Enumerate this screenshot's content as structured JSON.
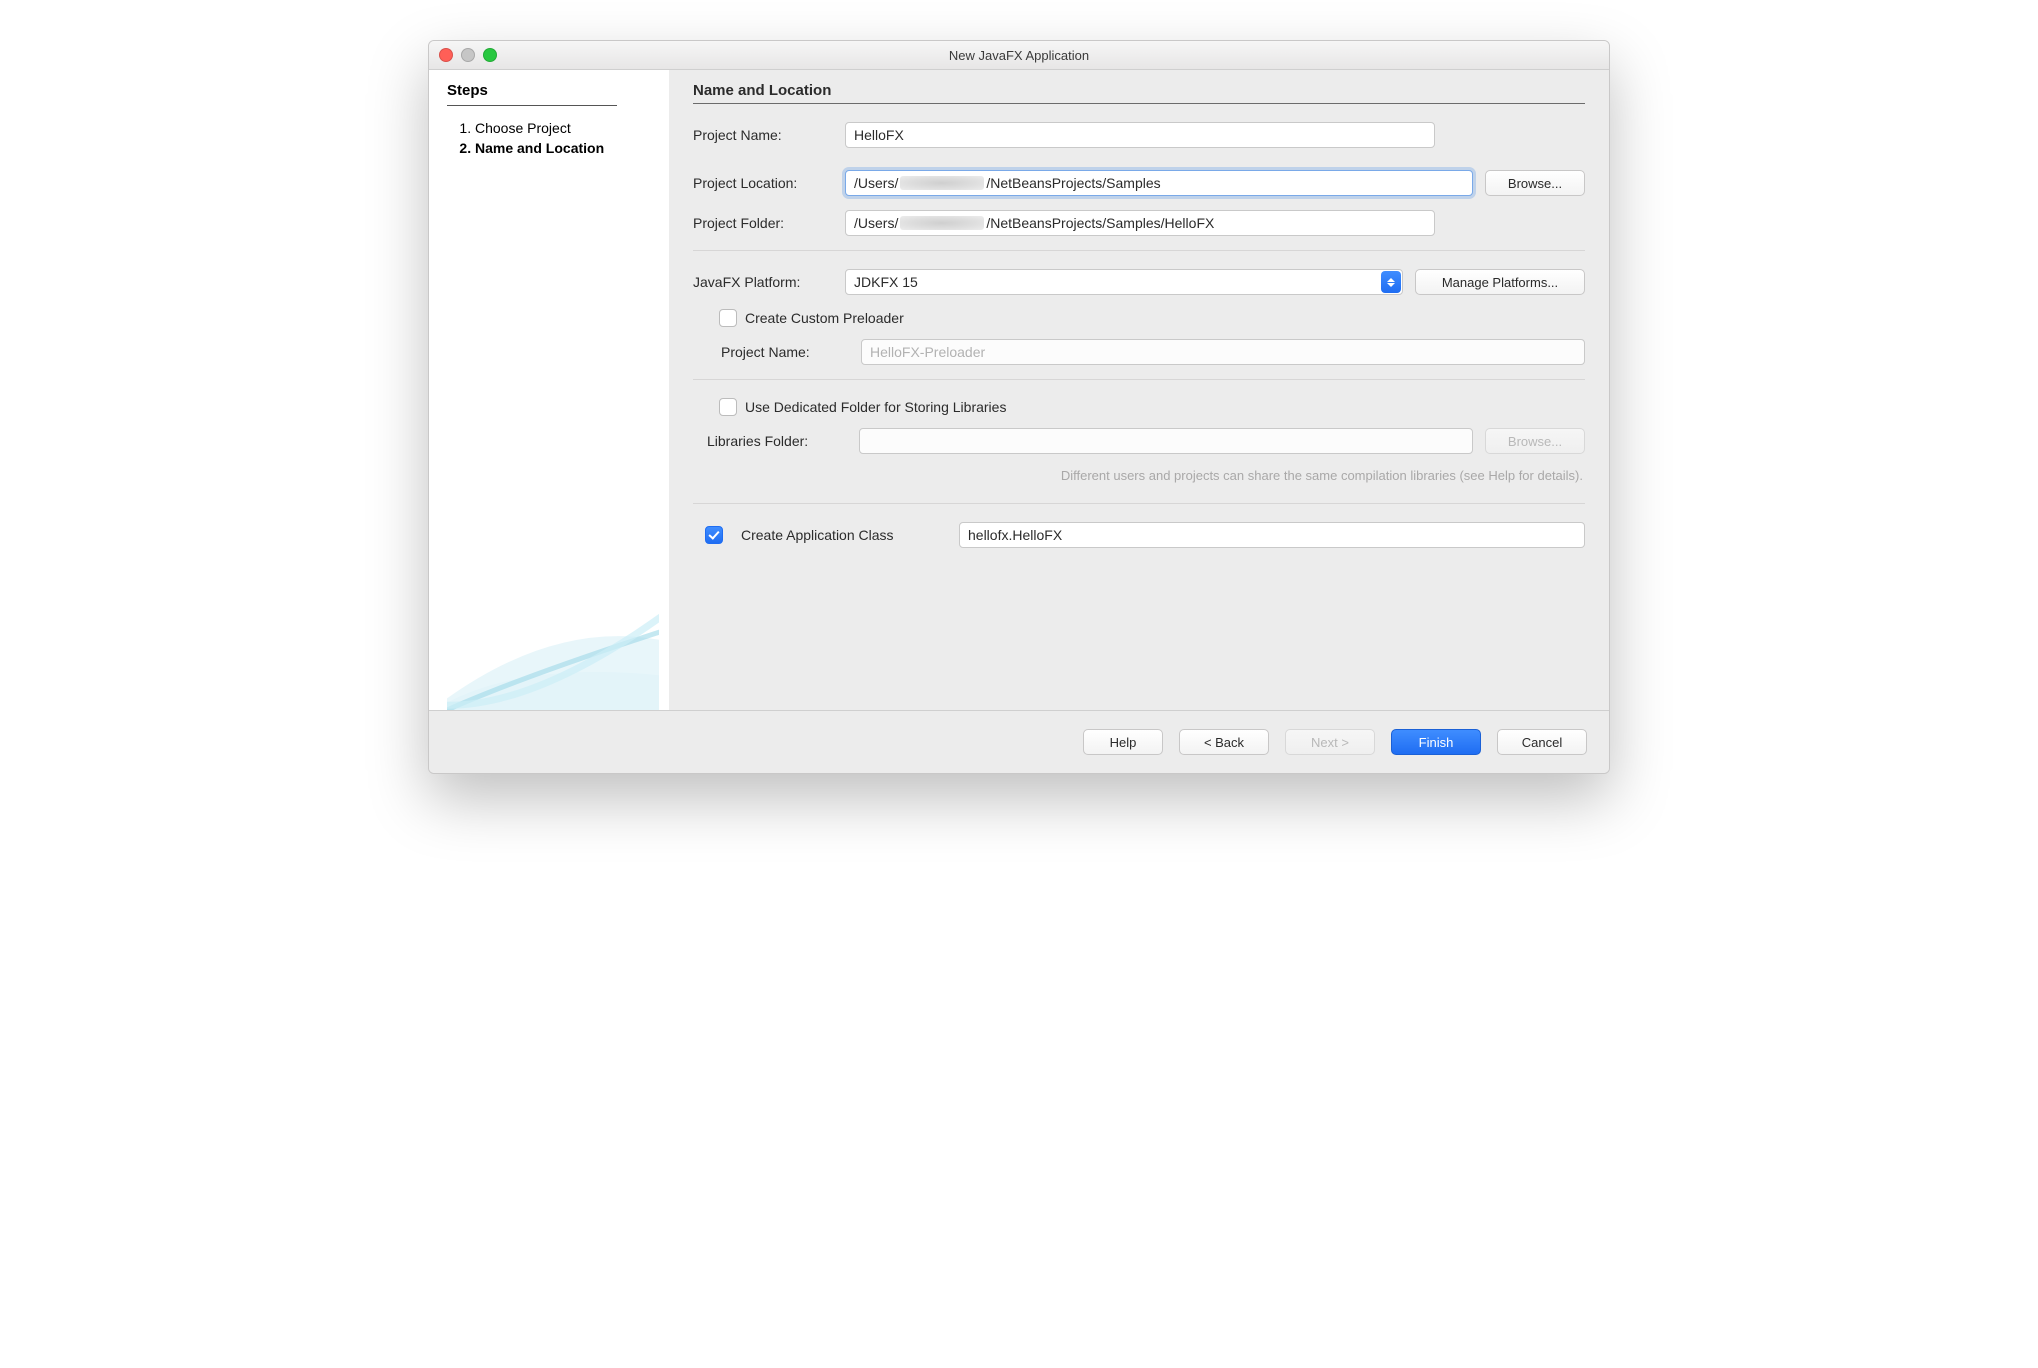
{
  "window": {
    "title": "New JavaFX Application"
  },
  "sidebar": {
    "heading": "Steps",
    "steps": [
      "Choose Project",
      "Name and Location"
    ],
    "current_index": 1
  },
  "main": {
    "heading": "Name and Location",
    "labels": {
      "project_name": "Project Name:",
      "project_location": "Project Location:",
      "project_folder": "Project Folder:",
      "javafx_platform": "JavaFX Platform:",
      "preloader_project_name": "Project Name:",
      "libraries_folder": "Libraries Folder:"
    },
    "values": {
      "project_name": "HelloFX",
      "location_prefix": "/Users/",
      "location_suffix": "/NetBeansProjects/Samples",
      "folder_prefix": "/Users/",
      "folder_suffix": "/NetBeansProjects/Samples/HelloFX",
      "javafx_platform": "JDKFX 15",
      "preloader_project_name": "HelloFX-Preloader",
      "libraries_folder": "",
      "app_class": "hellofx.HelloFX"
    },
    "buttons": {
      "browse_location": "Browse...",
      "manage_platforms": "Manage Platforms...",
      "browse_libraries": "Browse..."
    },
    "checks": {
      "create_preloader": {
        "label": "Create Custom Preloader",
        "checked": false
      },
      "use_dedicated_folder": {
        "label": "Use Dedicated Folder for Storing Libraries",
        "checked": false
      },
      "create_app_class": {
        "label": "Create Application Class",
        "checked": true
      }
    },
    "hint": "Different users and projects can share the same compilation libraries (see Help for details)."
  },
  "footer": {
    "help": "Help",
    "back": "< Back",
    "next": "Next >",
    "finish": "Finish",
    "cancel": "Cancel"
  }
}
